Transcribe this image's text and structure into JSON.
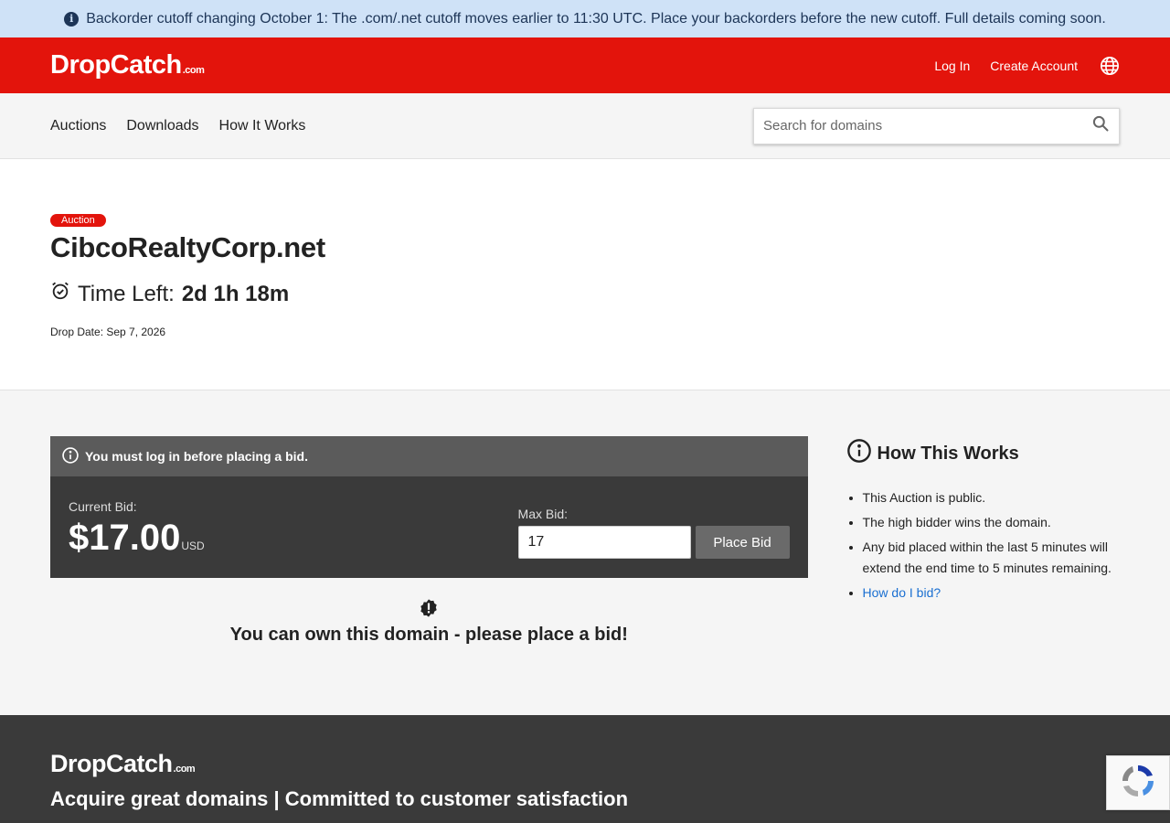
{
  "banner": {
    "text": "Backorder cutoff changing October 1: The .com/.net cutoff moves earlier to 11:30 UTC. Place your backorders before the new cutoff. Full details coming soon."
  },
  "header": {
    "logo_text": "DropCatch",
    "logo_suffix": ".com",
    "login_label": "Log In",
    "create_account_label": "Create Account"
  },
  "nav": {
    "items": [
      {
        "label": "Auctions"
      },
      {
        "label": "Downloads"
      },
      {
        "label": "How It Works"
      }
    ],
    "search_placeholder": "Search for domains"
  },
  "listing": {
    "badge": "Auction",
    "domain": "CibcoRealtyCorp.net",
    "time_left_label": "Time Left:",
    "time_left_value": "2d 1h 18m",
    "drop_date": "Drop Date: Sep 7, 2026"
  },
  "bid": {
    "login_notice": "You must log in before placing a bid.",
    "current_bid_label": "Current Bid:",
    "current_bid_amount": "$17.00",
    "currency": "USD",
    "max_bid_label": "Max Bid:",
    "max_bid_value": "17",
    "place_bid_label": "Place Bid",
    "cta_text": "You can own this domain - please place a bid!"
  },
  "how_it_works": {
    "title": "How This Works",
    "items": [
      "This Auction is public.",
      "The high bidder wins the domain.",
      "Any bid placed within the last 5 minutes will extend the end time to 5 minutes remaining."
    ],
    "link_label": "How do I bid?"
  },
  "footer": {
    "logo_text": "DropCatch",
    "logo_suffix": ".com",
    "tagline": "Acquire great domains | Committed to customer satisfaction"
  },
  "colors": {
    "brand_red": "#e3140c",
    "banner_bg": "#cfe2f7",
    "dark_panel": "#3a3a3a",
    "link_blue": "#1a6fd1"
  }
}
